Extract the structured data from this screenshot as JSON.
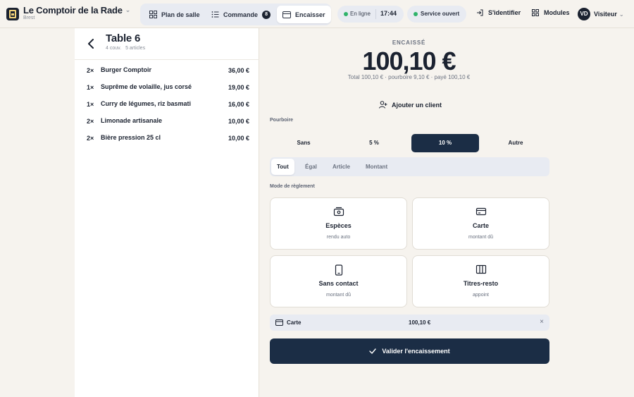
{
  "app": {
    "name": "Le Comptoir de la Rade",
    "location": "Brest"
  },
  "nav": {
    "tabs": [
      {
        "label": "Plan de salle",
        "icon": "grid-icon"
      },
      {
        "label": "Commande",
        "icon": "list-icon",
        "badge": "8"
      },
      {
        "label": "Encaisser",
        "icon": "card-icon",
        "active": true
      }
    ]
  },
  "status": {
    "online": "En ligne",
    "time": "17:44",
    "service": "Service ouvert",
    "online_color": "#2fb36a"
  },
  "actions": {
    "login": "S'identifier",
    "modules": "Modules"
  },
  "user": {
    "initials": "VD",
    "name": "Visiteur"
  },
  "table": {
    "title": "Table 6",
    "covers": "4 couv.",
    "articles": "5 articles"
  },
  "order_items": [
    {
      "qty": "2×",
      "name": "Burger Comptoir",
      "price": "36,00 €"
    },
    {
      "qty": "1×",
      "name": "Suprême de volaille, jus corsé",
      "price": "19,00 €"
    },
    {
      "qty": "1×",
      "name": "Curry de légumes, riz basmati",
      "price": "16,00 €"
    },
    {
      "qty": "2×",
      "name": "Limonade artisanale",
      "price": "10,00 €"
    },
    {
      "qty": "2×",
      "name": "Bière pression 25 cl",
      "price": "10,00 €"
    }
  ],
  "payment": {
    "label": "ENCAISSÉ",
    "amount": "100,10 €",
    "summary": "Total 100,10 € · pourboire 9,10 € · payé 100,10 €",
    "add_client": "Ajouter un client",
    "tip_label": "Pourboire",
    "tip_options": [
      "Sans",
      "5 %",
      "10 %",
      "Autre"
    ],
    "tip_selected": "10 %",
    "split_options": [
      "Tout",
      "Égal",
      "Article",
      "Montant"
    ],
    "split_selected": "Tout",
    "mode_label": "Mode de règlement",
    "methods": [
      {
        "title": "Espèces",
        "sub": "rendu auto",
        "icon": "cash-icon"
      },
      {
        "title": "Carte",
        "sub": "montant dû",
        "icon": "credit-card-icon"
      },
      {
        "title": "Sans contact",
        "sub": "montant dû",
        "icon": "contactless-icon"
      },
      {
        "title": "Titres-resto",
        "sub": "appoint",
        "icon": "voucher-icon"
      }
    ],
    "recorded": {
      "method": "Carte",
      "amount": "100,10 €",
      "remove": "×"
    },
    "validate": "Valider l'encaissement",
    "accent_color": "#1b2d45"
  }
}
